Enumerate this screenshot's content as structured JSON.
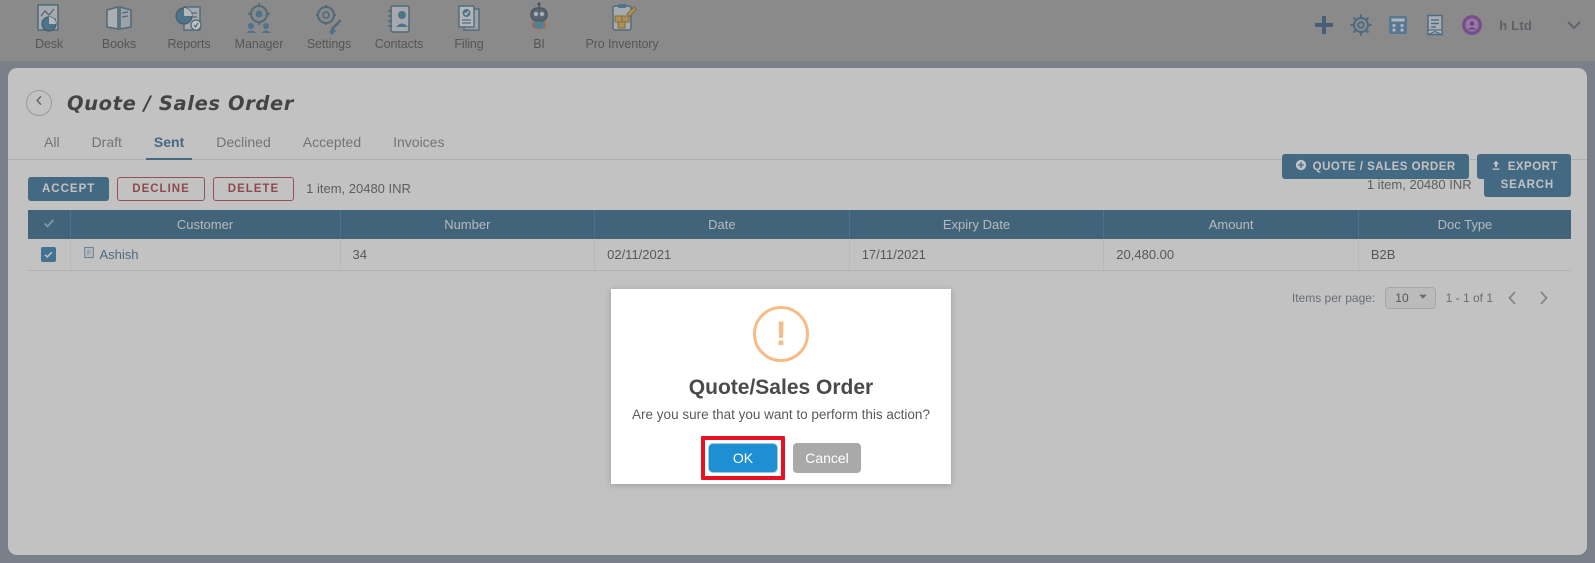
{
  "appbar": {
    "apps": [
      {
        "label": "Desk",
        "icon": "desk-chart-icon"
      },
      {
        "label": "Books",
        "icon": "books-open-book-icon"
      },
      {
        "label": "Reports",
        "icon": "reports-piechart-icon"
      },
      {
        "label": "Manager",
        "icon": "manager-gear-people-icon"
      },
      {
        "label": "Settings",
        "icon": "settings-wrench-gear-icon"
      },
      {
        "label": "Contacts",
        "icon": "contacts-card-icon"
      },
      {
        "label": "Filing",
        "icon": "filing-documents-icon"
      },
      {
        "label": "BI",
        "icon": "bi-robot-icon"
      },
      {
        "label": "Pro Inventory",
        "icon": "pro-inventory-clipboard-icon"
      }
    ],
    "right_icons": [
      {
        "name": "add-plus-icon"
      },
      {
        "name": "gear-icon"
      },
      {
        "name": "calculator-icon"
      },
      {
        "name": "notes-icon"
      },
      {
        "name": "user-badge-icon"
      }
    ],
    "org_name": "h Ltd",
    "chevron": "chevron-down-icon"
  },
  "page": {
    "title": "Quote / Sales Order",
    "back_icon": "back-chevron-icon",
    "actions": [
      {
        "label": "QUOTE / SALES ORDER",
        "icon": "plus-circle-icon"
      },
      {
        "label": "EXPORT",
        "icon": "upload-icon"
      }
    ]
  },
  "tabs": [
    {
      "label": "All",
      "active": false
    },
    {
      "label": "Draft",
      "active": false
    },
    {
      "label": "Sent",
      "active": true
    },
    {
      "label": "Declined",
      "active": false
    },
    {
      "label": "Accepted",
      "active": false
    },
    {
      "label": "Invoices",
      "active": false
    }
  ],
  "toolbar": {
    "accept_label": "ACCEPT",
    "decline_label": "DECLINE",
    "delete_label": "DELETE",
    "summary_left": "1 item, 20480 INR",
    "summary_right": "1 item, 20480 INR",
    "search_label": "SEARCH"
  },
  "table": {
    "headers": [
      "Customer",
      "Number",
      "Date",
      "Expiry Date",
      "Amount",
      "Doc Type"
    ],
    "select_all_icon": "check-icon",
    "rows": [
      {
        "checked": true,
        "doc_icon": "file-document-icon",
        "customer": "Ashish",
        "number": "34",
        "date": "02/11/2021",
        "expiry_date": "17/11/2021",
        "amount": "20,480.00",
        "doc_type": "B2B"
      }
    ]
  },
  "pager": {
    "items_per_page_label": "Items per page:",
    "items_per_page_value": "10",
    "range": "1 - 1 of 1",
    "prev_icon": "chevron-left-icon",
    "next_icon": "chevron-right-icon"
  },
  "modal": {
    "icon": "warning-exclamation-icon",
    "title": "Quote/Sales Order",
    "message": "Are you sure that you want to perform this action?",
    "ok_label": "OK",
    "cancel_label": "Cancel",
    "highlighted_button": "OK"
  },
  "colors": {
    "appbar_bg": "#9a9a9a",
    "page_bg": "#7b8799",
    "primary_blue": "#1b5e8a",
    "table_header_blue": "#17557f",
    "danger_red": "#b03040",
    "warn_orange": "#f8bb86",
    "ok_blue": "#1f8fd4",
    "highlight_red": "#e81123"
  }
}
